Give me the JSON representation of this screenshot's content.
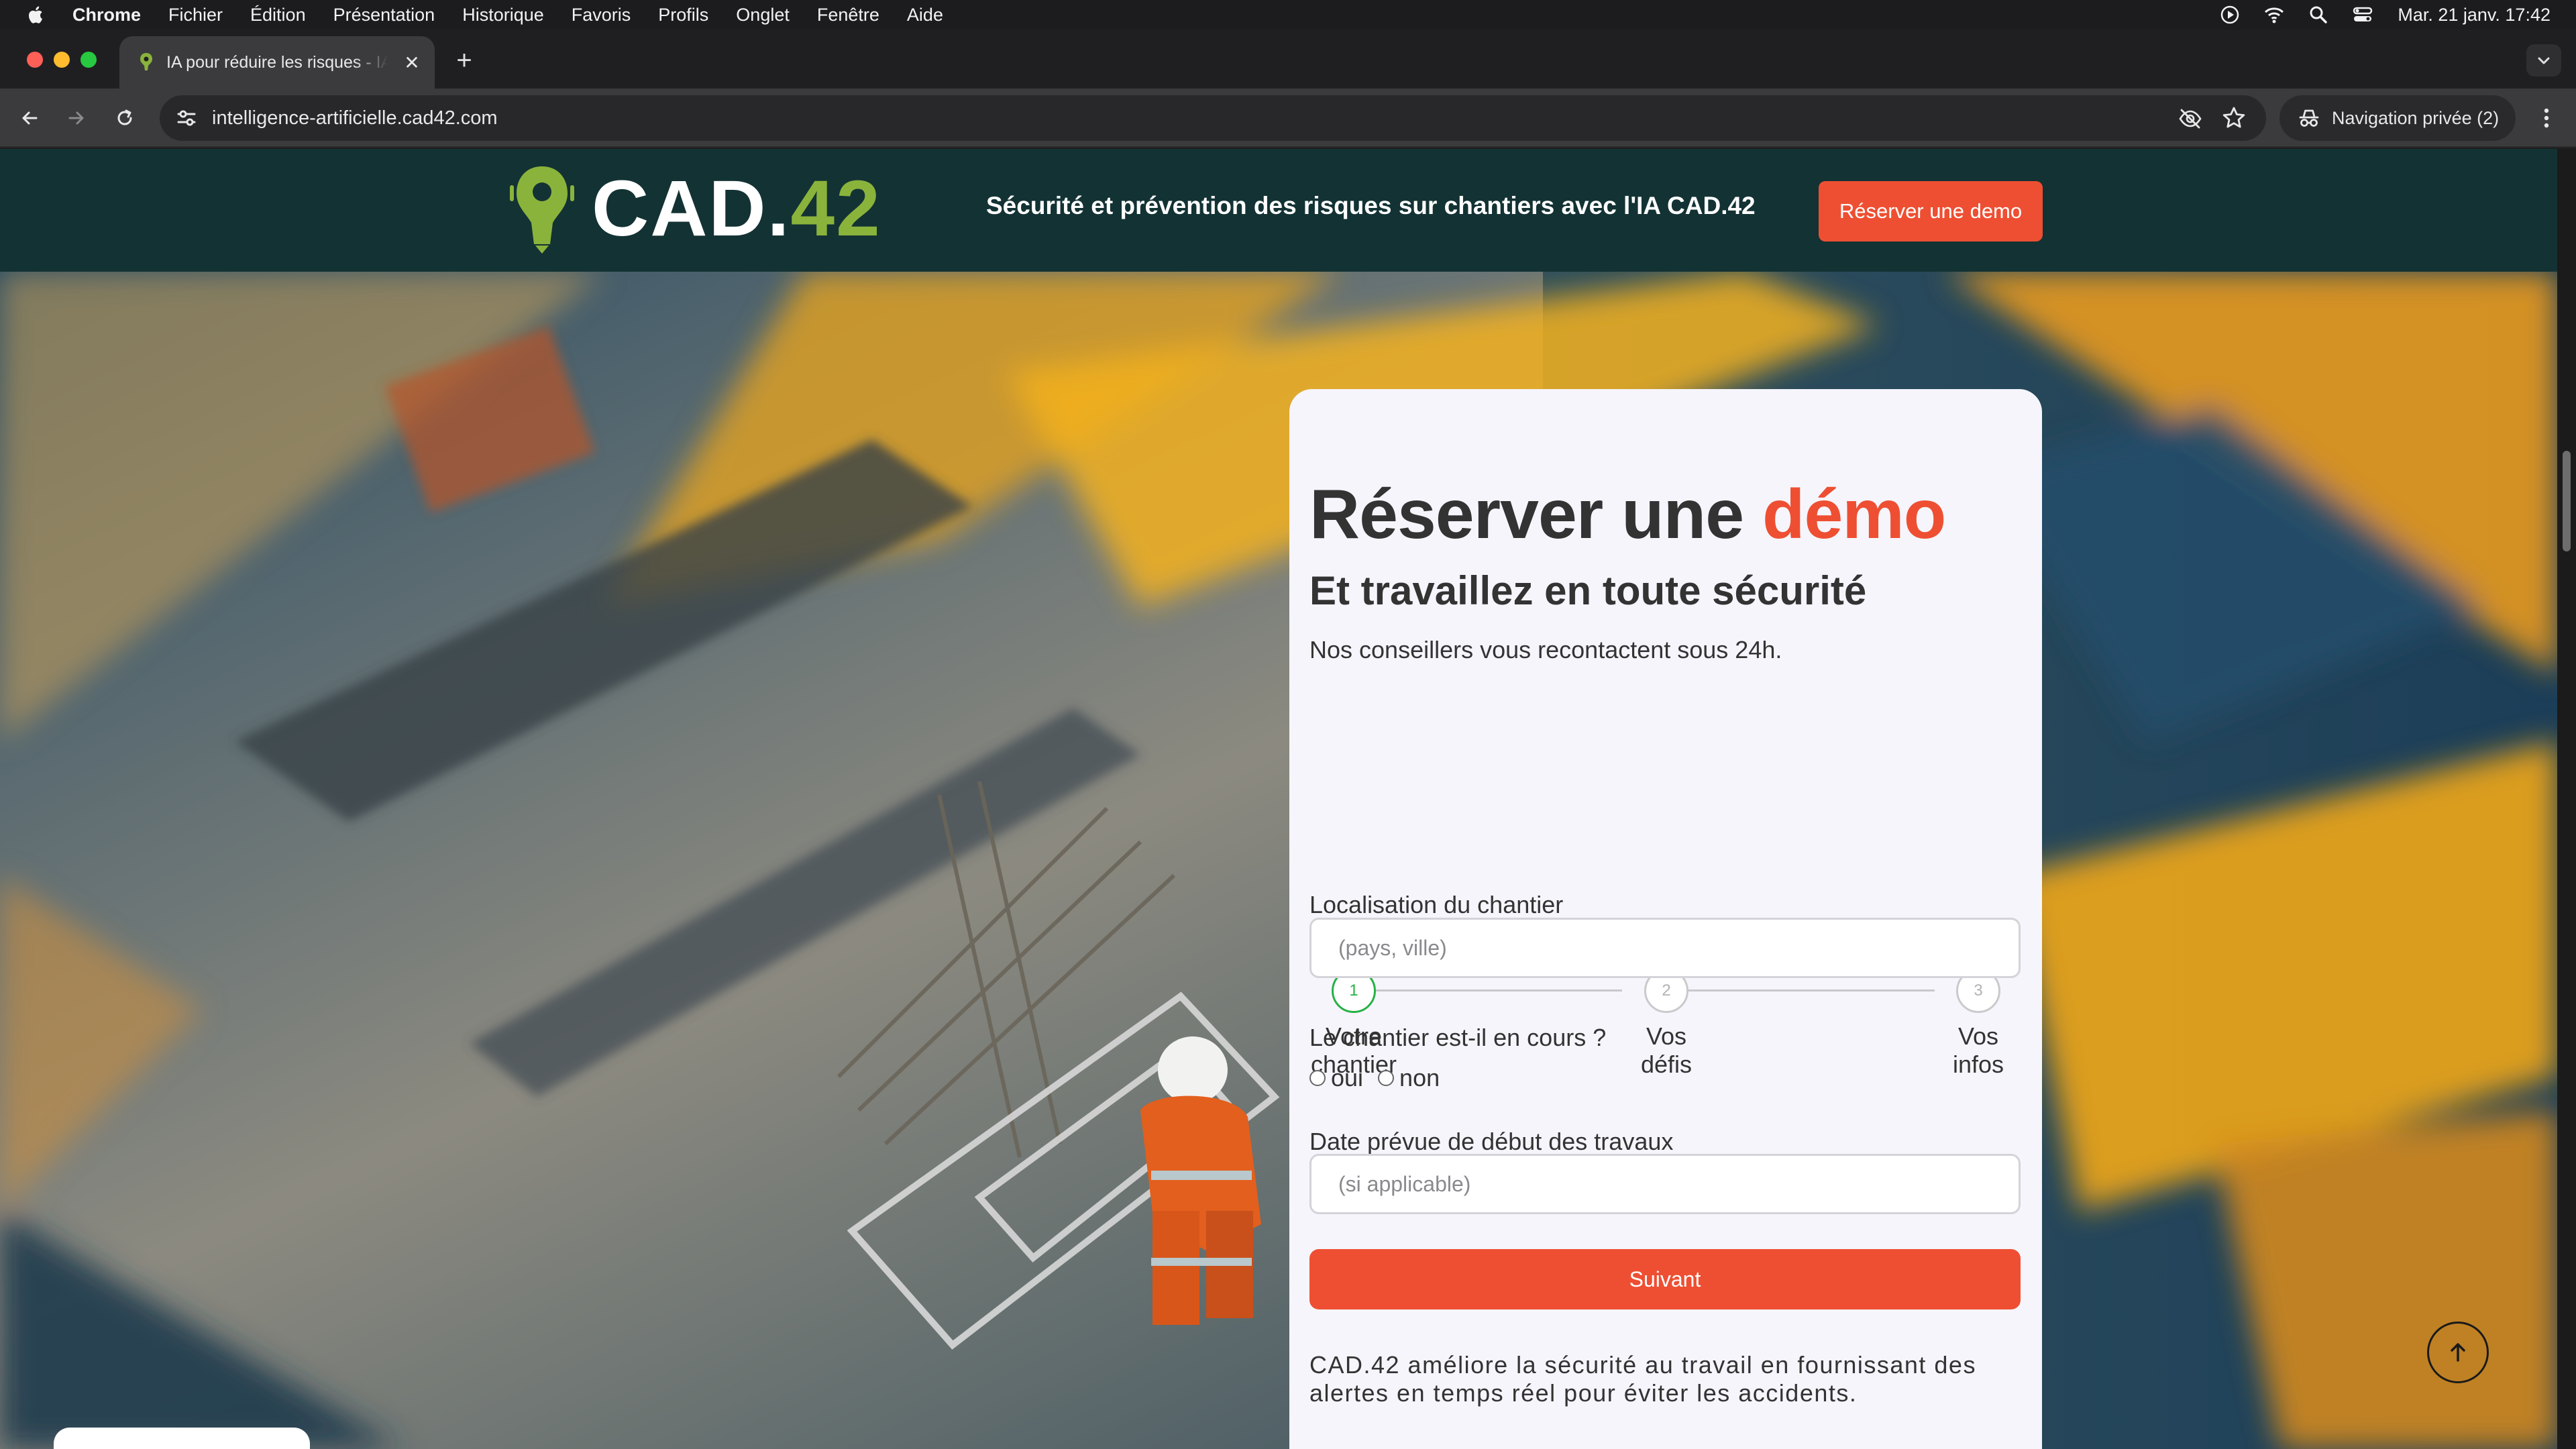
{
  "menubar": {
    "app": "Chrome",
    "items": [
      "Fichier",
      "Édition",
      "Présentation",
      "Historique",
      "Favoris",
      "Profils",
      "Onglet",
      "Fenêtre",
      "Aide"
    ],
    "clock": "Mar. 21 janv.  17:42"
  },
  "browser": {
    "tab_title": "IA pour réduire les risques - IA",
    "url": "intelligence-artificielle.cad42.com",
    "incognito_label": "Navigation privée (2)"
  },
  "header": {
    "brand_main": "CAD.",
    "brand_num": "42",
    "tagline": "Sécurité et prévention des risques sur chantiers avec l'IA CAD.42",
    "cta": "Réserver une demo"
  },
  "form": {
    "title_main": "Réserver une ",
    "title_accent": "démo",
    "subtitle": "Et travaillez en toute sécurité",
    "lead": "Nos conseillers vous recontactent sous 24h.",
    "steps": [
      {
        "num": "1",
        "line1": "Votre",
        "line2": "chantier"
      },
      {
        "num": "2",
        "line1": "Vos",
        "line2": "défis"
      },
      {
        "num": "3",
        "line1": "Vos",
        "line2": "infos"
      }
    ],
    "location_label": "Localisation du chantier",
    "location_placeholder": "(pays, ville)",
    "ongoing_label": "Le chantier est-il en cours ?",
    "opt_yes": "oui",
    "opt_no": "non",
    "date_label": "Date prévue de début des travaux",
    "date_placeholder": "(si applicable)",
    "submit": "Suivant",
    "note": "CAD.42 améliore la sécurité au travail en fournissant des alertes en temps réel pour éviter les accidents."
  },
  "colors": {
    "accent": "#ee4f32",
    "header_bg": "#133234",
    "brand_green": "#8ab33b",
    "step_active": "#27b146"
  }
}
